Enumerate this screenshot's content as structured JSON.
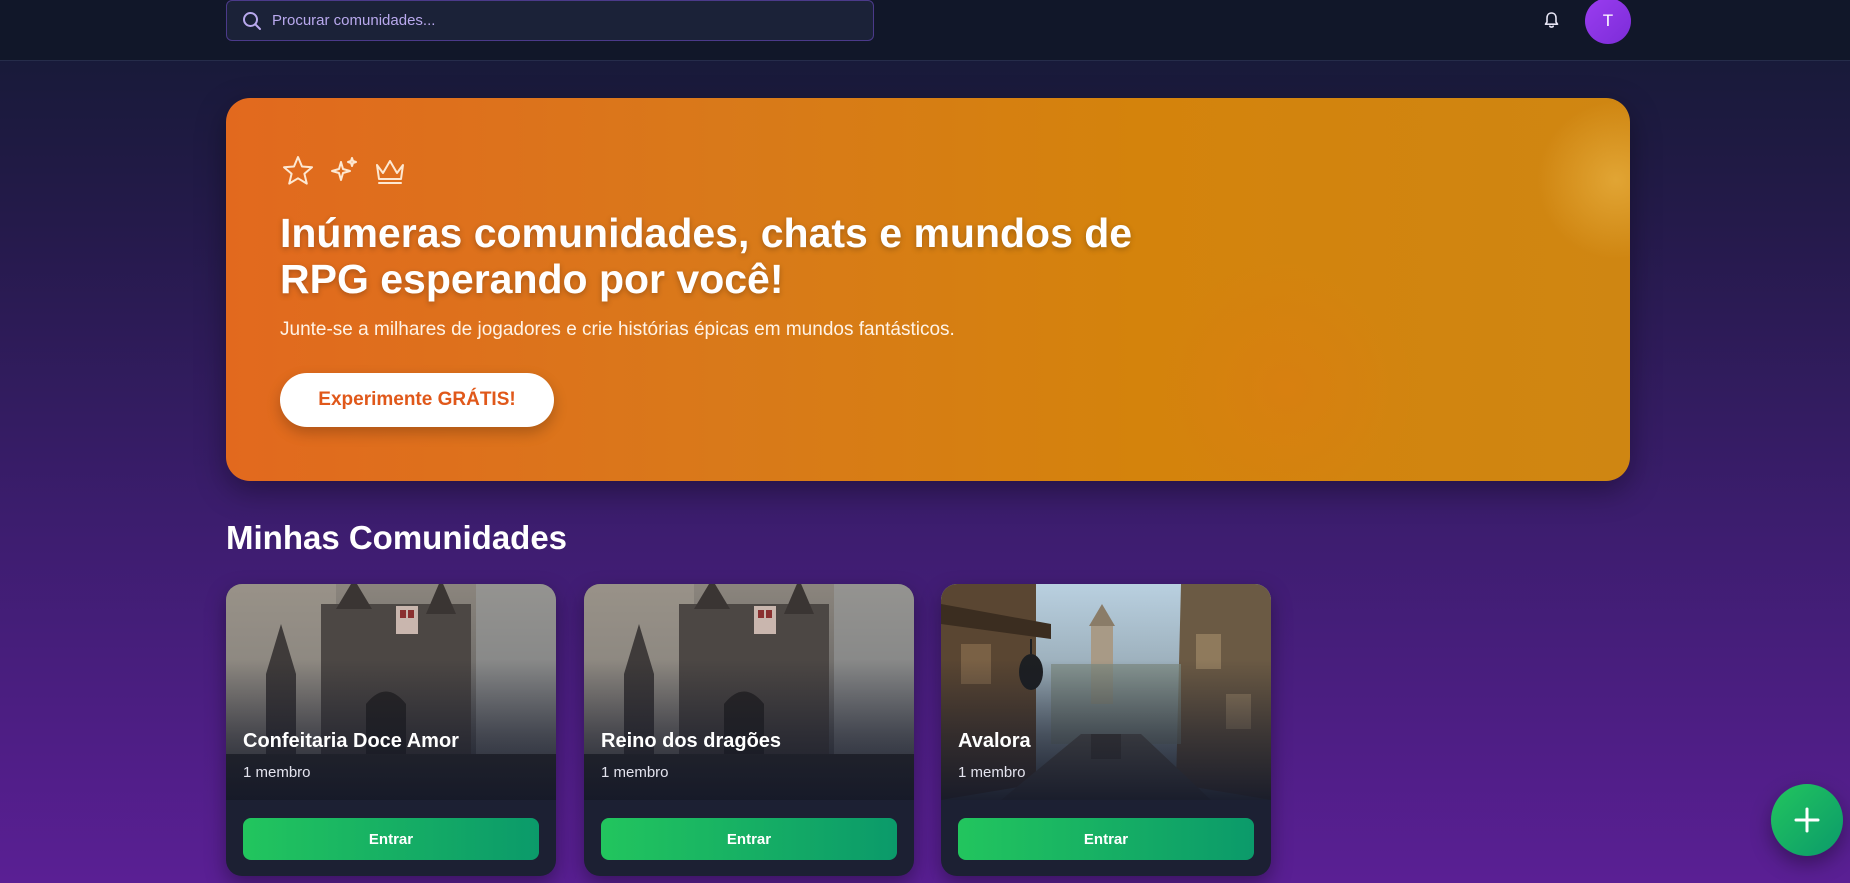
{
  "search": {
    "placeholder": "Procurar comunidades..."
  },
  "header": {
    "avatar_initial": "T"
  },
  "hero": {
    "title": "Inúmeras comunidades, chats e mundos de RPG esperando por você!",
    "subtitle": "Junte-se a milhares de jogadores e crie histórias épicas em mundos fantásticos.",
    "cta_label": "Experimente GRÁTIS!",
    "icons": [
      "star-icon",
      "sparkles-icon",
      "crown-icon"
    ]
  },
  "section": {
    "title": "Minhas Comunidades"
  },
  "communities": [
    {
      "name": "Confeitaria Doce Amor",
      "members": "1 membro",
      "button_label": "Entrar",
      "image": "castle"
    },
    {
      "name": "Reino dos dragões",
      "members": "1 membro",
      "button_label": "Entrar",
      "image": "castle"
    },
    {
      "name": "Avalora",
      "members": "1 membro",
      "button_label": "Entrar",
      "image": "medieval-street"
    }
  ],
  "colors": {
    "accent_orange": "#e0581a",
    "accent_green": "#22c55e",
    "avatar_purple": "#9a3df0"
  }
}
